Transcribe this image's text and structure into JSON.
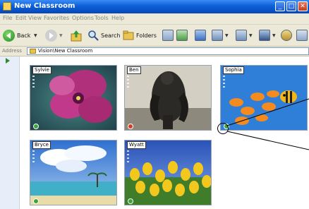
{
  "window": {
    "title": "New Classroom",
    "controls": [
      "_",
      "□",
      "✕"
    ]
  },
  "menubar": {
    "items": [
      "File",
      "Edit",
      "View",
      "Favorites",
      "Options",
      "Tools",
      "Help"
    ]
  },
  "toolbar": {
    "back_label": "Back",
    "search_label": "Search",
    "folders_label": "Folders"
  },
  "address": {
    "label": "Address",
    "path": "Vision\\New Classroom"
  },
  "students": [
    {
      "name": "Sylvie",
      "status": "green"
    },
    {
      "name": "Ben",
      "status": "red"
    },
    {
      "name": "Sophia",
      "status": "green"
    },
    {
      "name": "Bryce",
      "status": "green"
    },
    {
      "name": "Wyatt",
      "status": "green"
    }
  ],
  "colors": {
    "status_green": "#3aa53a",
    "status_red": "#d23c2a",
    "titlebar": "#0d5fd8",
    "leftpane": "#e7eef9"
  }
}
